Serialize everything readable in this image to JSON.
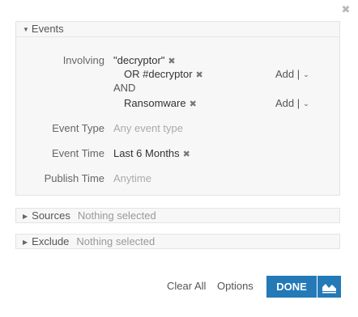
{
  "dialog": {
    "close_glyph": "✖"
  },
  "events": {
    "header": "Events",
    "involving": {
      "label": "Involving",
      "term1": "\"decryptor\"",
      "or_term": "OR #decryptor",
      "and_label": "AND",
      "term2": "Ransomware",
      "add_label": "Add",
      "separator": "|"
    },
    "event_type": {
      "label": "Event Type",
      "placeholder": "Any event type"
    },
    "event_time": {
      "label": "Event Time",
      "value": "Last 6 Months"
    },
    "publish_time": {
      "label": "Publish Time",
      "placeholder": "Anytime"
    }
  },
  "sources": {
    "header": "Sources",
    "value": "Nothing selected"
  },
  "exclude": {
    "header": "Exclude",
    "value": "Nothing selected"
  },
  "footer": {
    "clear_all": "Clear All",
    "options": "Options",
    "done": "DONE"
  },
  "colors": {
    "accent": "#2479b7",
    "panel_bg": "#f7f7f7"
  },
  "icons": [
    "close-icon",
    "caret-down-icon",
    "caret-right-icon",
    "remove-token-icon",
    "chevron-down-icon",
    "area-chart-icon"
  ]
}
